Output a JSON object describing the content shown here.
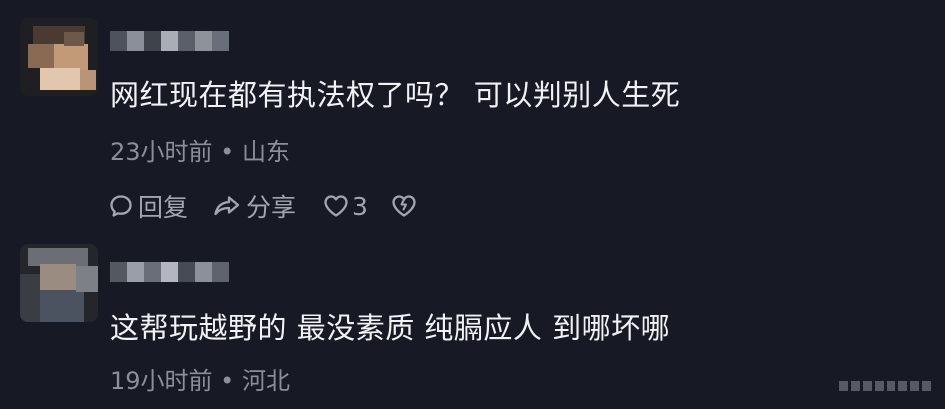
{
  "comments": [
    {
      "text": "网红现在都有执法权了吗？  可以判别人生死",
      "meta": "23小时前 • 山东",
      "reply_label": "回复",
      "share_label": "分享",
      "like_count": "3",
      "icons": {
        "reply": "comment-bubble-icon",
        "share": "share-arrow-icon",
        "like": "heart-outline-icon",
        "dislike": "broken-heart-icon"
      }
    },
    {
      "text": "这帮玩越野的 最没素质  纯膈应人 到哪坏哪",
      "meta": "19小时前 • 河北"
    }
  ],
  "colors": {
    "background": "#171a24",
    "text": "#f1f2f5",
    "meta": "#8b8f99",
    "action": "#a2a6b0"
  }
}
